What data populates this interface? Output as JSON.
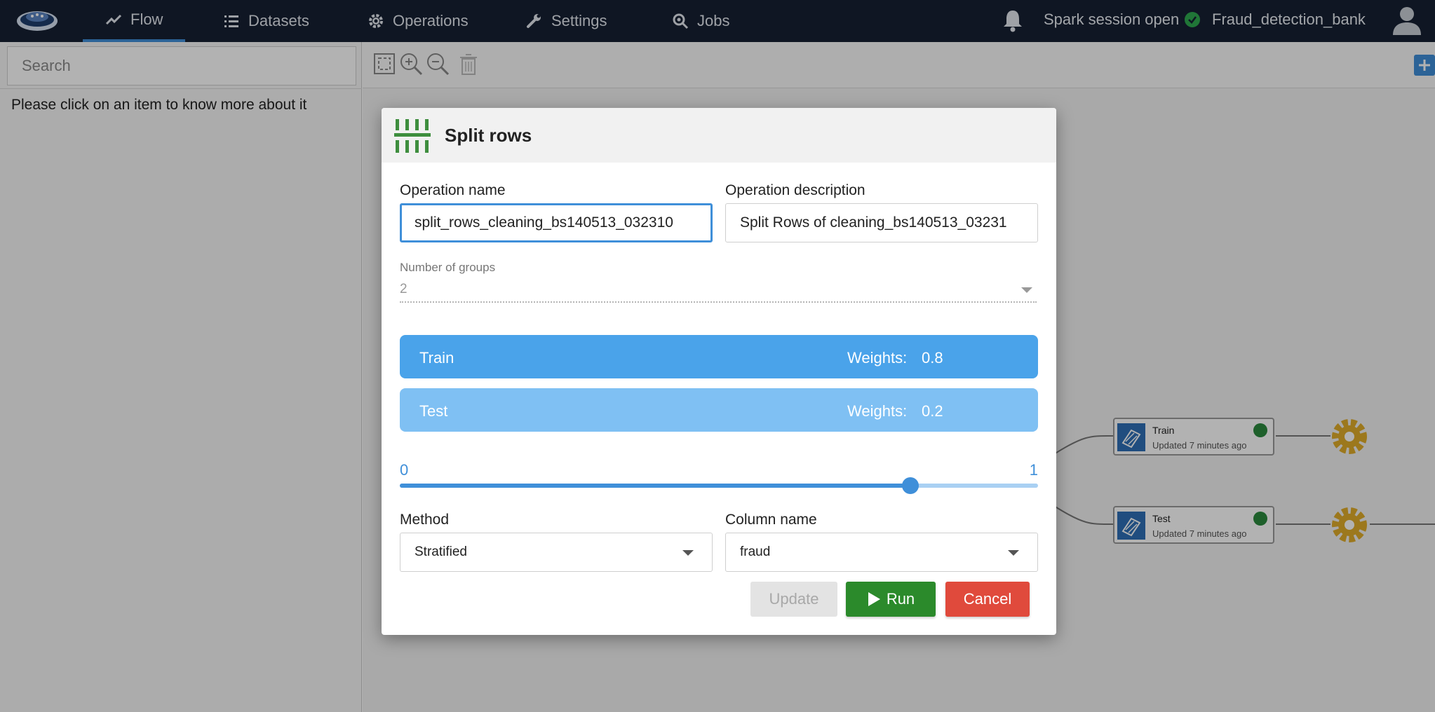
{
  "nav": {
    "items": [
      {
        "label": "Flow",
        "icon": "trend-icon",
        "active": true
      },
      {
        "label": "Datasets",
        "icon": "list-icon"
      },
      {
        "label": "Operations",
        "icon": "gear-icon"
      },
      {
        "label": "Settings",
        "icon": "wrench-icon"
      },
      {
        "label": "Jobs",
        "icon": "jobs-icon"
      }
    ],
    "session_status": "Spark session open",
    "project_name": "Fraud_detection_bank"
  },
  "sidebar": {
    "search_placeholder": "Search",
    "info_text": "Please click on an item to know more about it"
  },
  "canvas": {
    "nodes": [
      {
        "title": "Train",
        "subtitle": "Updated 7 minutes ago"
      },
      {
        "title": "Test",
        "subtitle": "Updated 7 minutes ago"
      }
    ]
  },
  "modal": {
    "title": "Split rows",
    "operation_name_label": "Operation name",
    "operation_name_value": "split_rows_cleaning_bs140513_032310",
    "operation_description_label": "Operation description",
    "operation_description_value": "Split Rows of cleaning_bs140513_03231",
    "number_of_groups_label": "Number of groups",
    "number_of_groups_value": "2",
    "groups": [
      {
        "name": "Train",
        "weights_label": "Weights:",
        "weight": "0.8"
      },
      {
        "name": "Test",
        "weights_label": "Weights:",
        "weight": "0.2"
      }
    ],
    "slider": {
      "min_label": "0",
      "max_label": "1",
      "value": 0.8
    },
    "method_label": "Method",
    "method_value": "Stratified",
    "column_name_label": "Column name",
    "column_name_value": "fraud",
    "buttons": {
      "update": "Update",
      "run": "Run",
      "cancel": "Cancel"
    }
  },
  "colors": {
    "nav_bg": "#162033",
    "accent": "#3f8fd9",
    "train_row": "#4aa3ea",
    "test_row": "#7fc0f3",
    "run": "#2b8a2b",
    "cancel": "#e04a3c",
    "split_icon": "#3e8e3e",
    "gear": "#e0ac2a"
  }
}
